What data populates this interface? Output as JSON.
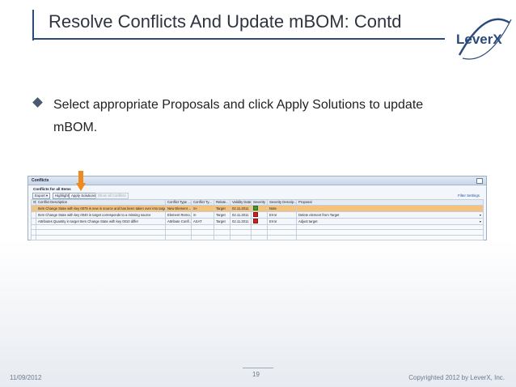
{
  "slide": {
    "title": "Resolve Conflicts And Update mBOM: Contd",
    "bullet_line1": "Select appropriate Proposals and click Apply Solutions to update",
    "bullet_line2": "mBOM.",
    "logo_text": "LeverX",
    "footer_date": "11/09/2012",
    "page_number": "19",
    "copyright": "Copyrighted 2012 by LeverX, Inc."
  },
  "panel": {
    "title": "Conflicts",
    "subtitle": "Conflicts for all Items",
    "toolbar": {
      "export": "Export ▾",
      "highlight": "Highlight",
      "apply": "Apply Solutions",
      "show_all": "Show all Conflicts",
      "filter": "Filter  Settings"
    },
    "columns": [
      "Conflict Description",
      "Conflict Type ...",
      "Conflict Ty...",
      "Relate...",
      "Validity Date",
      "Severity",
      "Severity Descrip...",
      "Proposal"
    ],
    "rows": [
      {
        "desc": "Item Change State with key 0075 is new in source and has been taken over into target",
        "type": "New Element ...",
        "ty": "S+",
        "rel": "Target",
        "date": "02.11.2011",
        "sev": "ok",
        "sevdesc": "Note",
        "proposal": ""
      },
      {
        "desc": "Item Change State with key 0040 in target corresponds to a missing source",
        "type": "Element Remo...",
        "ty": "S-",
        "rel": "Target",
        "date": "02.11.2011",
        "sev": "err",
        "sevdesc": "Error",
        "proposal": "Delete element from Target"
      },
      {
        "desc": "Attributes Quantity in target Item Change State with key 0010 differ",
        "type": "Attribute Confl...",
        "ty": "ASAT",
        "rel": "Target",
        "date": "02.11.2011",
        "sev": "err",
        "sevdesc": "Error",
        "proposal": "Adjust target"
      }
    ]
  },
  "colors": {
    "accent": "#2b4a7a",
    "highlight_row": "#f4c27a",
    "arrow": "#f08a1c"
  }
}
